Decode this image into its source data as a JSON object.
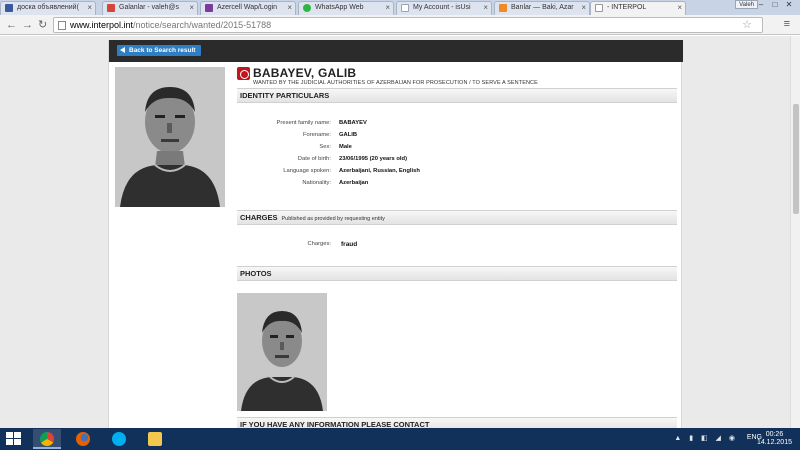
{
  "browser": {
    "tabs": [
      {
        "label": "доска объявлений(",
        "favicon_color": "#3b5998"
      },
      {
        "label": "Galanlar - valeh@s",
        "favicon_color": "#d44638"
      },
      {
        "label": "Azercell Wap/Login",
        "favicon_color": "#7a3b9a"
      },
      {
        "label": "WhatsApp Web",
        "favicon_color": "#2cb742"
      },
      {
        "label": "My Account - isUsi",
        "favicon_color": "#9aa6b8"
      },
      {
        "label": "Banlar — Baki, Azar",
        "favicon_color": "#f08a24"
      },
      {
        "label": "- INTERPOL",
        "favicon_color": "#ffffff"
      }
    ],
    "user_button": "Valeh",
    "url_host": "www.interpol.int",
    "url_path": "/notice/search/wanted/2015-51788"
  },
  "notice": {
    "back_button": "Back to Search result",
    "name": "BABAYEV, GALIB",
    "wanted_by": "WANTED BY THE JUDICIAL AUTHORITIES OF AZERBAIJAN FOR PROSECUTION / TO SERVE A SENTENCE",
    "identity_heading": "IDENTITY PARTICULARS",
    "identity": {
      "family_name_label": "Present family name:",
      "family_name": "BABAYEV",
      "forename_label": "Forename:",
      "forename": "GALIB",
      "sex_label": "Sex:",
      "sex": "Male",
      "dob_label": "Date of birth:",
      "dob": "23/06/1995 (20 years old)",
      "languages_label": "Language spoken:",
      "languages": "Azerbaijani, Russian, English",
      "nationality_label": "Nationality:",
      "nationality": "Azerbaijan"
    },
    "charges_heading": "CHARGES",
    "charges_sub": "Published as provided by requesting entity",
    "charges_label": "Charges:",
    "charges_value": "fraud",
    "photos_heading": "PHOTOS",
    "contact_heading": "IF YOU HAVE ANY INFORMATION PLEASE CONTACT"
  },
  "taskbar": {
    "language": "ENG",
    "time": "00:26",
    "date": "14.12.2015"
  }
}
